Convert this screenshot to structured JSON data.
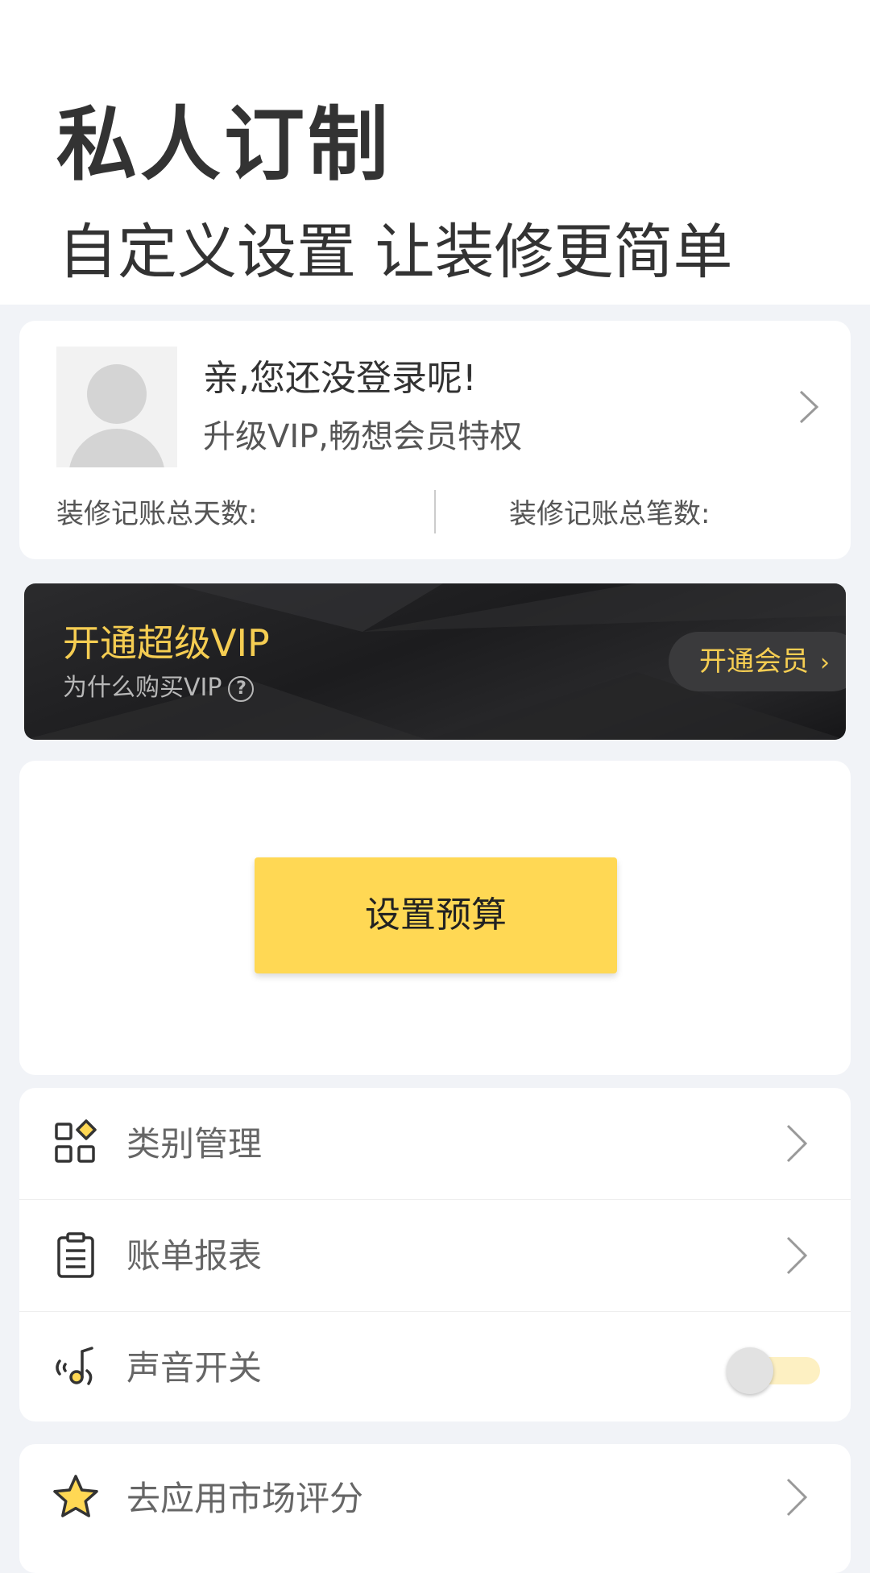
{
  "header": {
    "title": "私人订制",
    "subtitle": "自定义设置 让装修更简单"
  },
  "profile": {
    "login_prompt": "亲,您还没登录呢!",
    "vip_prompt": "升级VIP,畅想会员特权",
    "stats": {
      "total_days_label": "装修记账总天数:",
      "total_entries_label": "装修记账总笔数:"
    }
  },
  "vip_banner": {
    "title": "开通超级VIP",
    "why_label": "为什么购买VIP",
    "why_icon": "question-circle-icon",
    "button_label": "开通会员",
    "button_chevron": "›",
    "accent_color": "#f5cd52"
  },
  "budget": {
    "button_label": "设置预算",
    "button_color": "#ffd854"
  },
  "menu": {
    "items": [
      {
        "label": "类别管理",
        "icon": "category-grid-icon",
        "control": "chevron"
      },
      {
        "label": "账单报表",
        "icon": "clipboard-report-icon",
        "control": "chevron"
      },
      {
        "label": "声音开关",
        "icon": "sound-icon",
        "control": "toggle",
        "toggle_on": false
      }
    ]
  },
  "rate": {
    "label": "去应用市场评分",
    "icon": "star-icon"
  }
}
